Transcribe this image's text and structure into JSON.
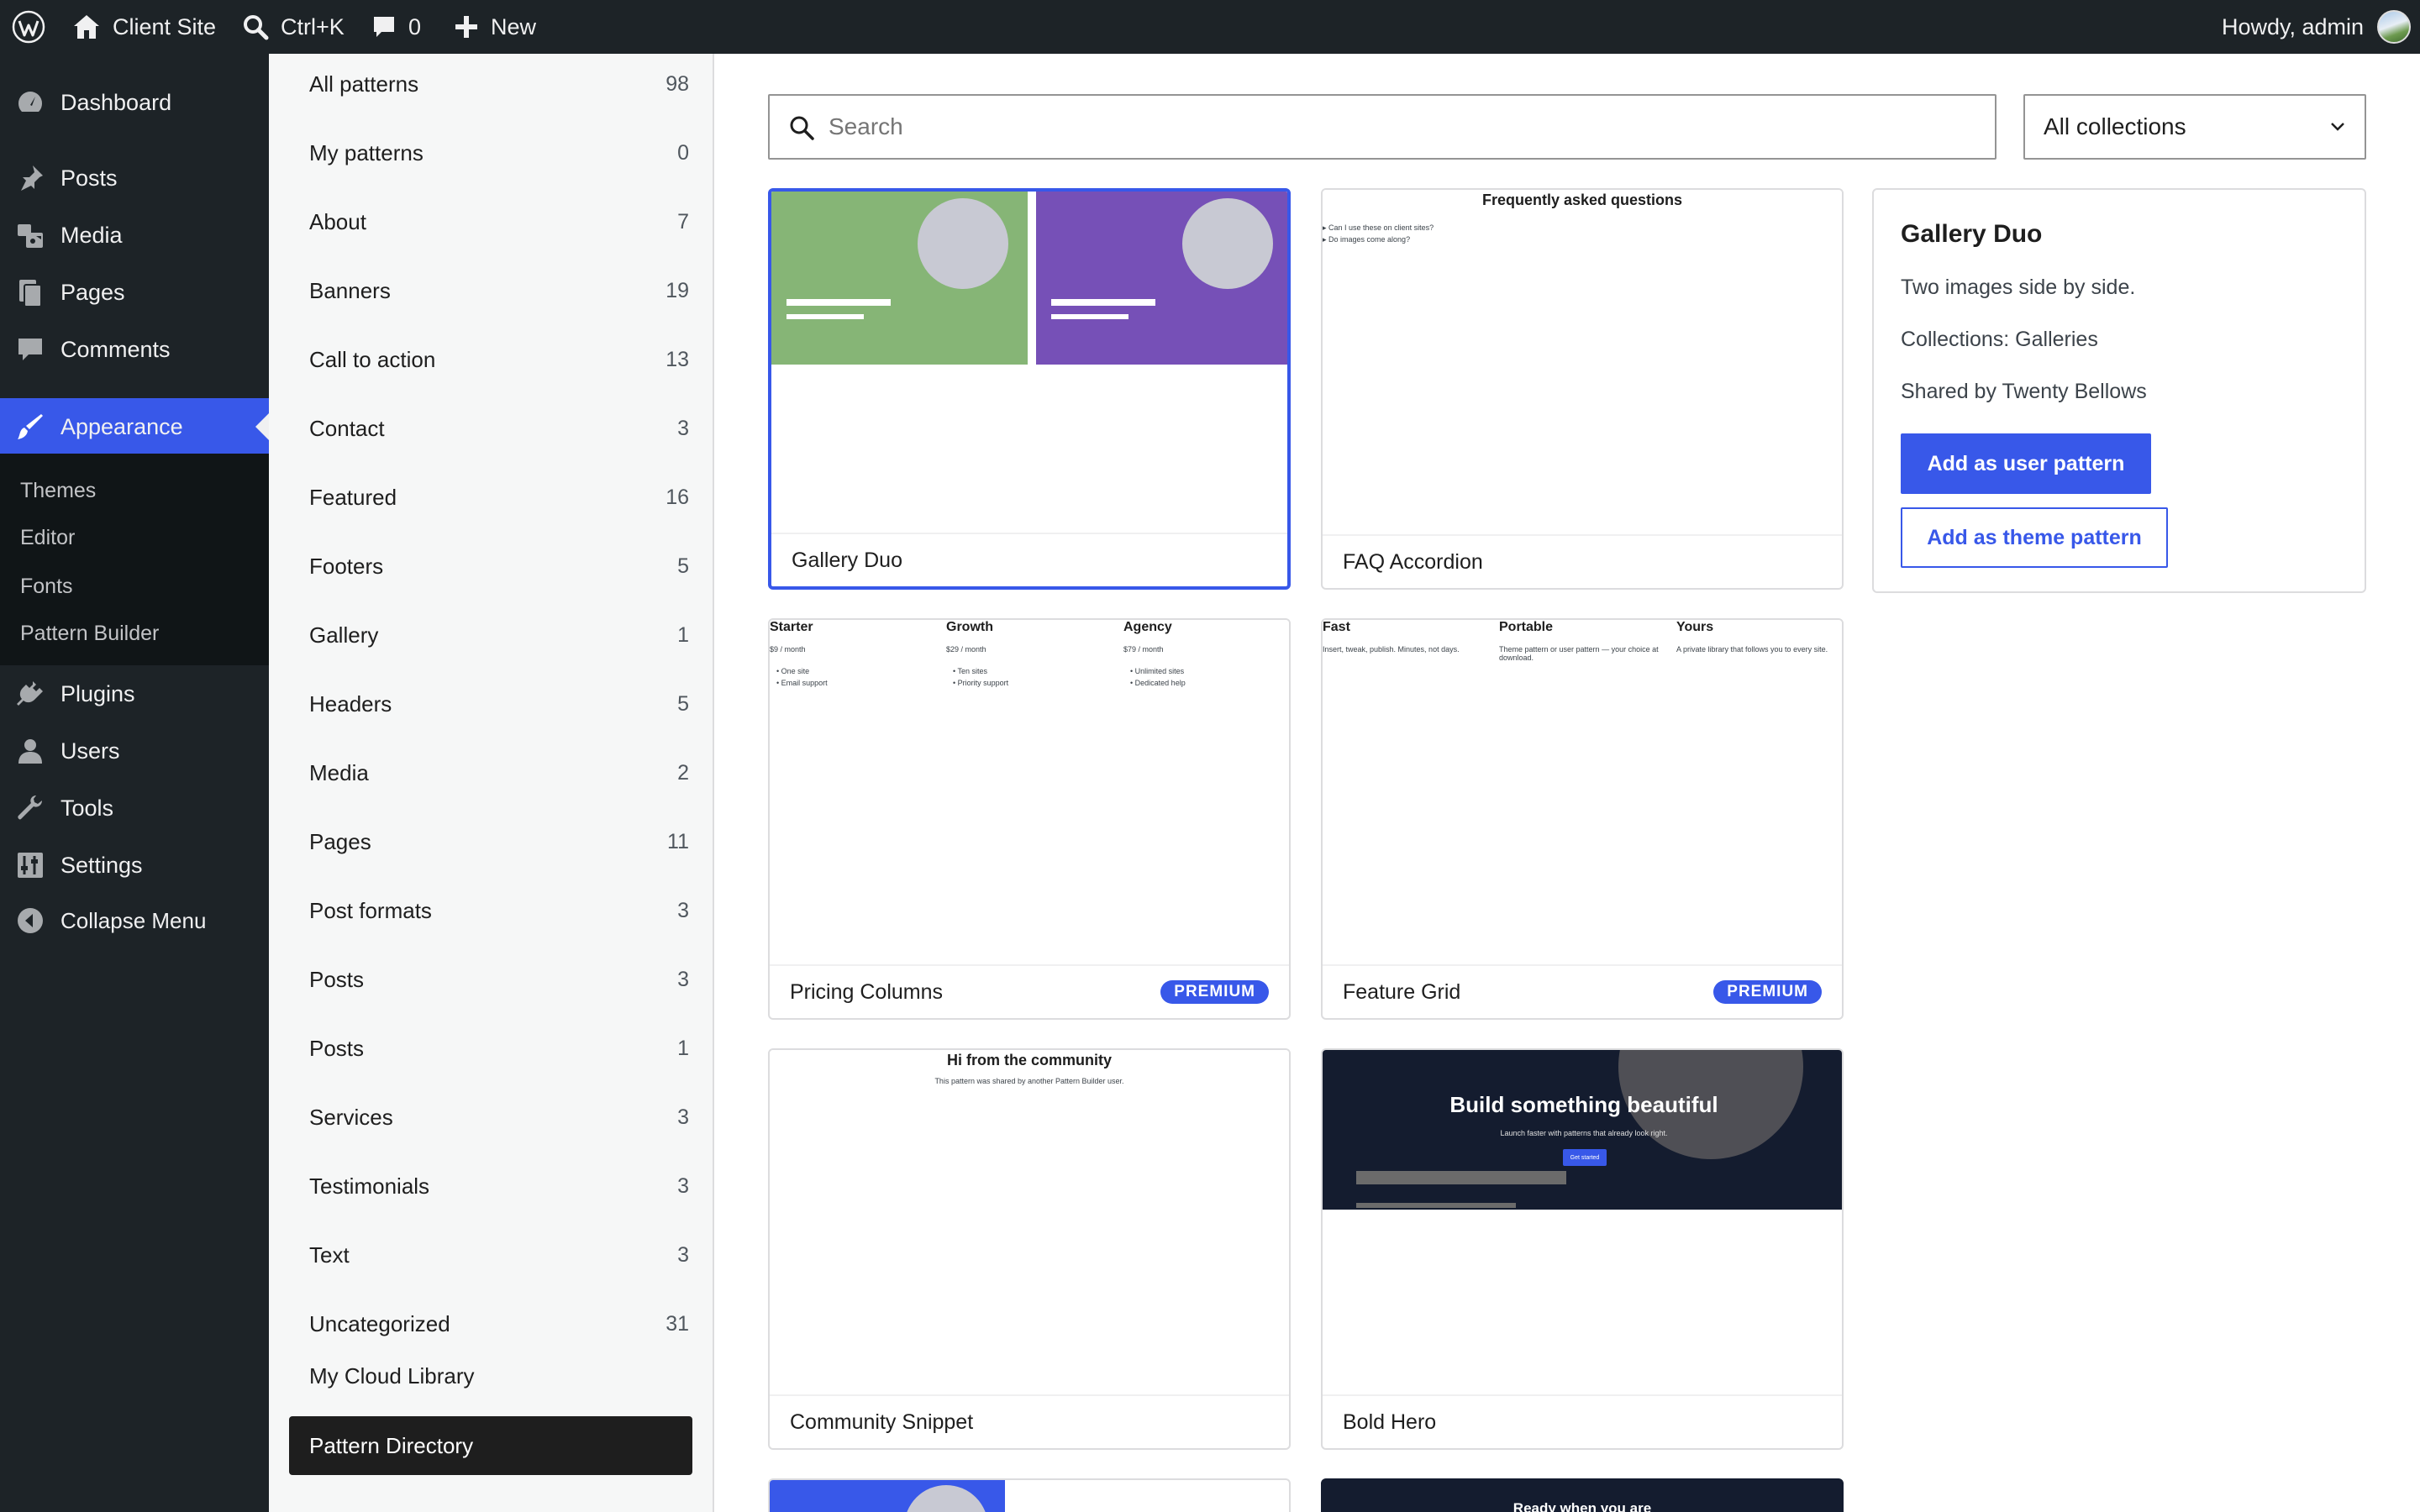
{
  "adminbar": {
    "site_name": "Client Site",
    "search_shortcut": "Ctrl+K",
    "comments_count": "0",
    "new_label": "New",
    "greeting": "Howdy, admin"
  },
  "menu": {
    "dashboard": "Dashboard",
    "posts": "Posts",
    "media": "Media",
    "pages": "Pages",
    "comments": "Comments",
    "appearance": "Appearance",
    "submenu": [
      "Themes",
      "Editor",
      "Fonts",
      "Pattern Builder"
    ],
    "plugins": "Plugins",
    "users": "Users",
    "tools": "Tools",
    "settings": "Settings",
    "collapse": "Collapse Menu"
  },
  "categories": [
    {
      "label": "All patterns",
      "count": "98"
    },
    {
      "label": "My patterns",
      "count": "0"
    },
    {
      "label": "About",
      "count": "7"
    },
    {
      "label": "Banners",
      "count": "19"
    },
    {
      "label": "Call to action",
      "count": "13"
    },
    {
      "label": "Contact",
      "count": "3"
    },
    {
      "label": "Featured",
      "count": "16"
    },
    {
      "label": "Footers",
      "count": "5"
    },
    {
      "label": "Gallery",
      "count": "1"
    },
    {
      "label": "Headers",
      "count": "5"
    },
    {
      "label": "Media",
      "count": "2"
    },
    {
      "label": "Pages",
      "count": "11"
    },
    {
      "label": "Post formats",
      "count": "3"
    },
    {
      "label": "Posts",
      "count": "3"
    },
    {
      "label": "Posts",
      "count": "1"
    },
    {
      "label": "Services",
      "count": "3"
    },
    {
      "label": "Testimonials",
      "count": "3"
    },
    {
      "label": "Text",
      "count": "3"
    },
    {
      "label": "Uncategorized",
      "count": "31"
    }
  ],
  "cloud_library": "My Cloud Library",
  "pattern_directory": "Pattern Directory",
  "search": {
    "placeholder": "Search"
  },
  "collections_select": "All collections",
  "cards": {
    "gallery_duo": {
      "name": "Gallery Duo"
    },
    "faq": {
      "name": "FAQ Accordion",
      "title": "Frequently asked questions",
      "q1": "▸ Can I use these on client sites?",
      "q2": "▸ Do images come along?"
    },
    "pricing": {
      "name": "Pricing Columns",
      "badge": "PREMIUM",
      "cols": [
        {
          "name": "Starter",
          "price": "$9 / month",
          "f1": "One site",
          "f2": "Email support"
        },
        {
          "name": "Growth",
          "price": "$29 / month",
          "f1": "Ten sites",
          "f2": "Priority support"
        },
        {
          "name": "Agency",
          "price": "$79 / month",
          "f1": "Unlimited sites",
          "f2": "Dedicated help"
        }
      ]
    },
    "feature": {
      "name": "Feature Grid",
      "badge": "PREMIUM",
      "cols": [
        {
          "name": "Fast",
          "text": "Insert, tweak, publish. Minutes, not days."
        },
        {
          "name": "Portable",
          "text": "Theme pattern or user pattern — your choice at download."
        },
        {
          "name": "Yours",
          "text": "A private library that follows you to every site."
        }
      ]
    },
    "community": {
      "name": "Community Snippet",
      "title": "Hi from the community",
      "text": "This pattern was shared by another Pattern Builder user."
    },
    "bold_hero": {
      "name": "Bold Hero",
      "title": "Build something beautiful",
      "text": "Launch faster with patterns that already look right.",
      "button": "Get started"
    },
    "ready": {
      "title": "Ready when you are"
    }
  },
  "detail": {
    "title": "Gallery Duo",
    "description": "Two images side by side.",
    "collections": "Collections: Galleries",
    "shared_by": "Shared by Twenty Bellows",
    "primary_button": "Add as user pattern",
    "secondary_button": "Add as theme pattern"
  },
  "colors": {
    "accent": "#3858e9",
    "admin_dark": "#1d2327",
    "gallery_green": "#86b576",
    "gallery_purple": "#7650b7",
    "hero_dark": "#141c2f"
  }
}
